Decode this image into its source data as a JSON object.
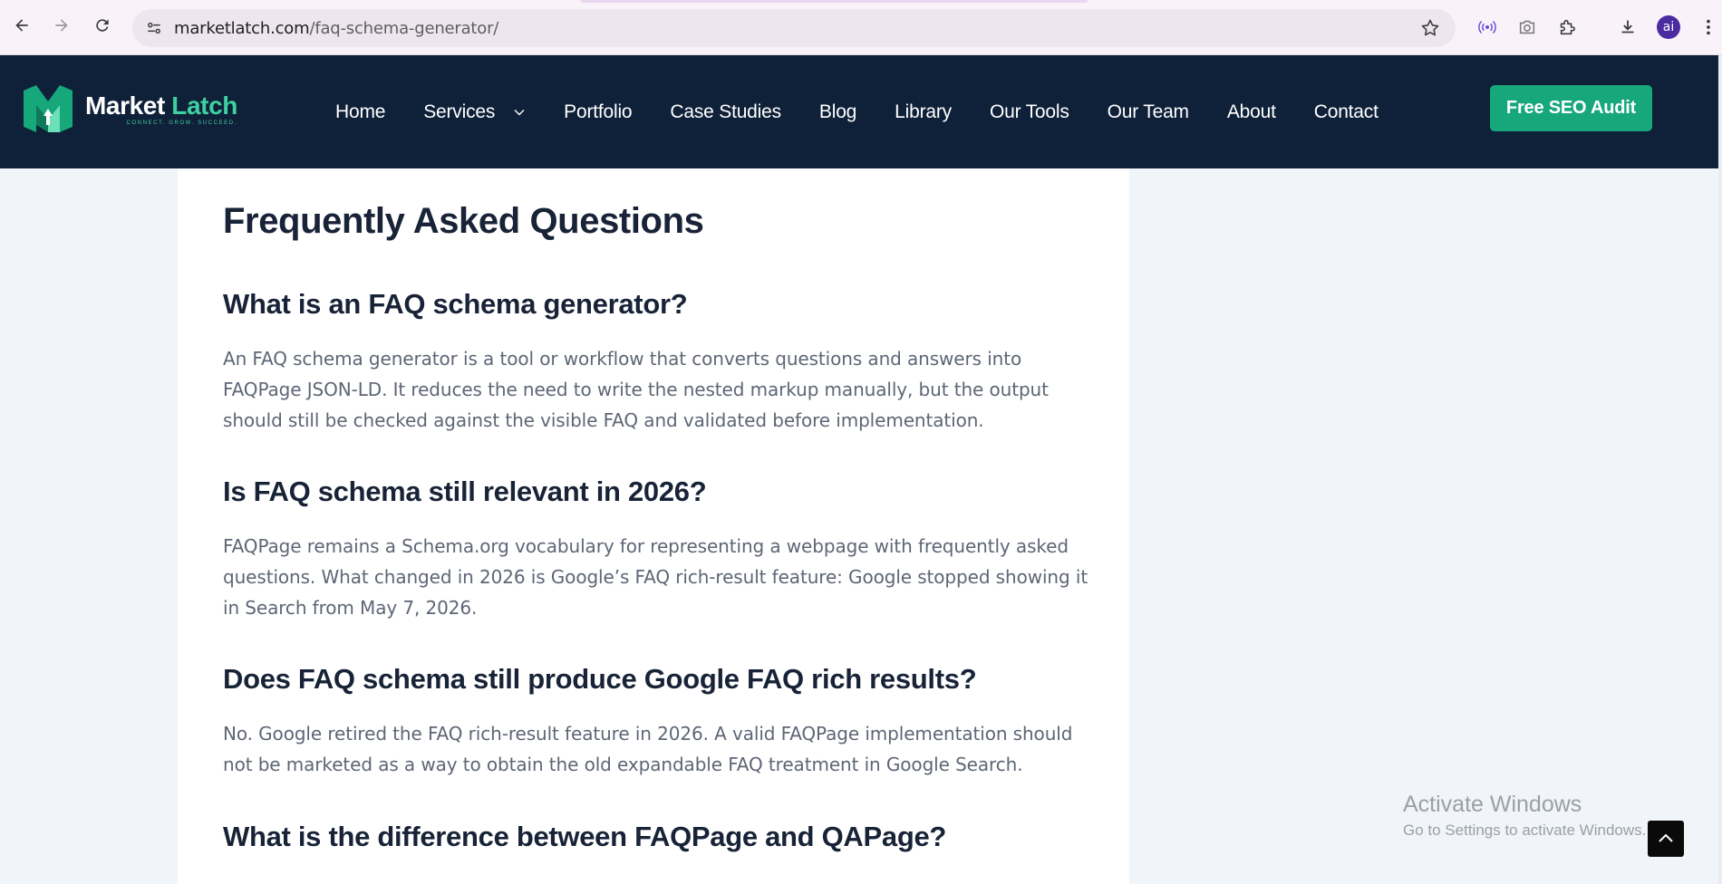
{
  "browser": {
    "url_host": "marketlatch.com",
    "url_path": "/faq-schema-generator/",
    "avatar_initials": "ai"
  },
  "header": {
    "logo_name_part1": "Market",
    "logo_name_part2": "Latch",
    "logo_tagline": "CONNECT. GROW. SUCCEED.",
    "nav": [
      "Home",
      "Services",
      "Portfolio",
      "Case Studies",
      "Blog",
      "Library",
      "Our Tools",
      "Our Team",
      "About",
      "Contact"
    ],
    "cta_label": "Free SEO Audit"
  },
  "faq": {
    "title": "Frequently Asked Questions",
    "items": [
      {
        "q": "What is an FAQ schema generator?",
        "a": "An FAQ schema generator is a tool or workflow that converts questions and answers into FAQPage JSON-LD. It reduces the need to write the nested markup manually, but the output should still be checked against the visible FAQ and validated before implementation."
      },
      {
        "q": "Is FAQ schema still relevant in 2026?",
        "a": "FAQPage remains a Schema.org vocabulary for representing a webpage with frequently asked questions. What changed in 2026 is Google’s FAQ rich-result feature: Google stopped showing it in Search from May 7, 2026."
      },
      {
        "q": "Does FAQ schema still produce Google FAQ rich results?",
        "a": "No. Google retired the FAQ rich-result feature in 2026. A valid FAQPage implementation should not be marketed as a way to obtain the old expandable FAQ treatment in Google Search."
      },
      {
        "q": "What is the difference between FAQPage and QAPage?",
        "a": ""
      }
    ]
  },
  "watermark": {
    "line1": "Activate Windows",
    "line2": "Go to Settings to activate Windows."
  },
  "colors": {
    "header_bg": "#0f2039",
    "brand_green": "#16a77a",
    "logo_accent": "#3fd0a0",
    "heading": "#182337",
    "body_text": "#5e6675"
  }
}
